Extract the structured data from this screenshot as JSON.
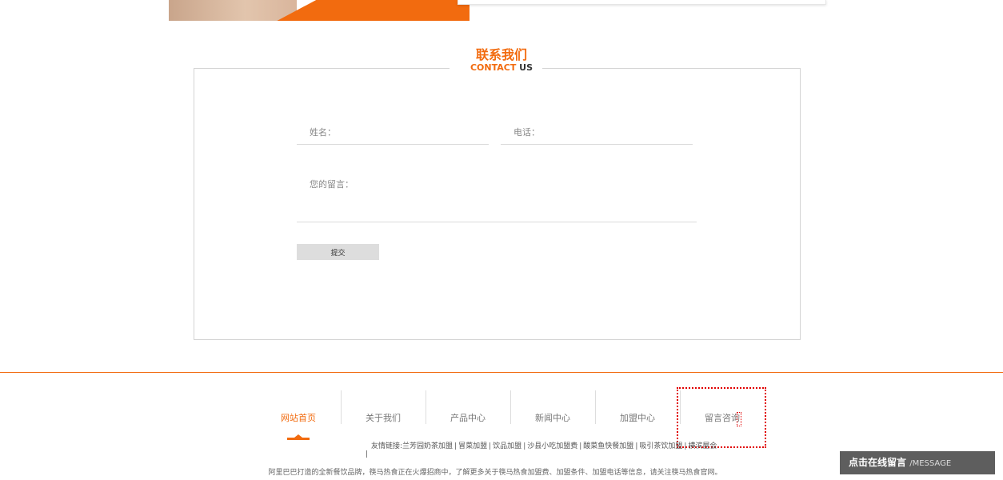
{
  "section": {
    "title": "联系我们",
    "subtitle_orange": "CONTACT",
    "subtitle_dark": "US"
  },
  "form": {
    "name_placeholder": "姓名：",
    "phone_placeholder": "电话：",
    "message_placeholder": "您的留言：",
    "submit_label": "提交"
  },
  "nav": {
    "items": [
      {
        "label": "网站首页",
        "active": true
      },
      {
        "label": "关于我们"
      },
      {
        "label": "产品中心"
      },
      {
        "label": "新闻中心"
      },
      {
        "label": "加盟中心"
      },
      {
        "label": "留言咨询"
      }
    ]
  },
  "friend_links": {
    "prefix": "友情链接:",
    "items": [
      "兰芳园奶茶加盟",
      "冒菜加盟",
      "饮品加盟",
      "沙县小吃加盟费",
      "酸菜鱼快餐加盟",
      "吸引茶饮加盟",
      "横滨屋会"
    ]
  },
  "copyright": "阿里巴巴打造的全新餐饮品牌，筷马热食正在火爆招商中，了解更多关于筷马热食加盟费、加盟条件、加盟电话等信息，请关注筷马热食官网。",
  "message_button": {
    "label": "点击在线留言",
    "en_label": "/MESSAGE"
  },
  "colors": {
    "accent": "#f26b0f",
    "button_bg": "#5e5e5e",
    "focus_outline": "#e00000"
  }
}
